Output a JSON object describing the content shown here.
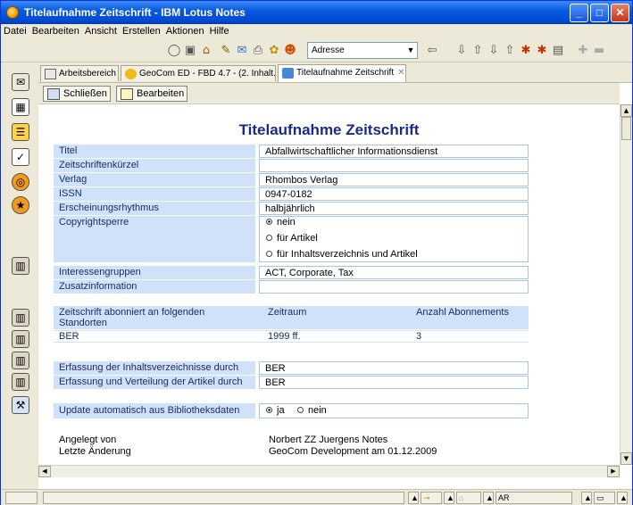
{
  "window": {
    "title": "Titelaufnahme Zeitschrift - IBM Lotus Notes",
    "controls": {
      "minimize": "_",
      "maximize": "□",
      "close": "✕"
    }
  },
  "menu": [
    "Datei",
    "Bearbeiten",
    "Ansicht",
    "Erstellen",
    "Aktionen",
    "Hilfe"
  ],
  "toolbar": {
    "address_label": "Adresse",
    "dropdown_glyph": "▼"
  },
  "tabs": [
    {
      "label": "Arbeitsbereich",
      "icon": "workspace-icon",
      "closable": false
    },
    {
      "label": "GeoCom ED - FBD 4.7 - (2. Inhalt...",
      "icon": "database-icon",
      "closable": true
    },
    {
      "label": "Titelaufnahme Zeitschrift",
      "icon": "document-icon",
      "closable": true,
      "active": true
    }
  ],
  "tab_close_glyph": "✕",
  "actions": {
    "close_label": "Schließen",
    "edit_label": "Bearbeiten"
  },
  "form": {
    "title": "Titelaufnahme Zeitschrift",
    "fields": [
      {
        "label": "Titel",
        "value": "Abfallwirtschaftlicher Informationsdienst"
      },
      {
        "label": "Zeitschriftenkürzel",
        "value": ""
      },
      {
        "label": "Verlag",
        "value": "Rhombos Verlag"
      },
      {
        "label": "ISSN",
        "value": "0947-0182"
      },
      {
        "label": "Erscheinungsrhythmus",
        "value": "halbjährlich"
      }
    ],
    "copyright": {
      "label": "Copyrightsperre",
      "options": [
        "nein",
        "für Artikel",
        "für Inhaltsverzeichnis und Artikel"
      ],
      "selected": "nein"
    },
    "interest": {
      "label": "Interessengruppen",
      "value": "ACT, Corporate, Tax"
    },
    "info": {
      "label": "Zusatzinformation",
      "value": ""
    },
    "subscriptions": {
      "headers": [
        "Zeitschrift abonniert an folgenden Standorten",
        "Zeitraum",
        "Anzahl Abonnements"
      ],
      "rows": [
        {
          "location": "BER",
          "period": "1999 ff.",
          "count": "3"
        }
      ]
    },
    "capture_toc": {
      "label": "Erfassung der Inhaltsverzeichnisse durch",
      "value": "BER"
    },
    "capture_articles": {
      "label": "Erfassung und Verteilung der Artikel durch",
      "value": "BER"
    },
    "auto_update": {
      "label": "Update automatisch aus Bibliotheksdaten",
      "options": [
        "ja",
        "nein"
      ],
      "selected": "ja"
    },
    "created_by": {
      "label": "Angelegt von",
      "value": "Norbert ZZ Juergens Notes"
    },
    "last_change": {
      "label": "Letzte Änderung",
      "value": "GeoCom Development am 01.12.2009"
    }
  },
  "status": {
    "language": "AR"
  }
}
